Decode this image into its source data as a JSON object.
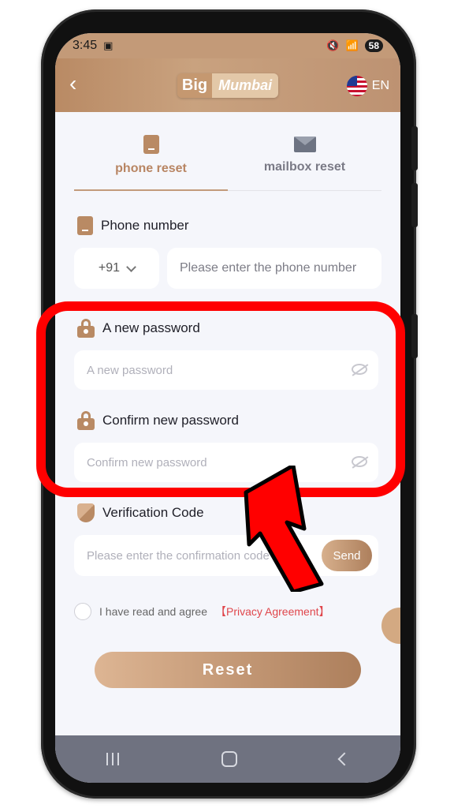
{
  "status_bar": {
    "time": "3:45",
    "battery": "58"
  },
  "header": {
    "logo_first": "Big",
    "logo_rest": "Mumbai",
    "language": "EN",
    "back_icon": "chevron-left-icon",
    "flag_icon": "us-flag-icon"
  },
  "tabs": [
    {
      "label": "phone reset",
      "icon": "phone-icon",
      "active": true
    },
    {
      "label": "mailbox reset",
      "icon": "mail-icon",
      "active": false
    }
  ],
  "form": {
    "phone_label": "Phone number",
    "country_code": "+91",
    "phone_placeholder": "Please enter the phone number",
    "new_password_label": "A new password",
    "new_password_placeholder": "A new password",
    "confirm_password_label": "Confirm new password",
    "confirm_password_placeholder": "Confirm new password",
    "verification_label": "Verification Code",
    "verification_placeholder": "Please enter the confirmation code",
    "send_label": "Send"
  },
  "agreement": {
    "text": "I have read and agree",
    "link": "【Privacy Agreement】"
  },
  "reset_label": "Reset",
  "colors": {
    "brand": "#b98a64",
    "highlight": "#ff0000",
    "link": "#e0464b"
  }
}
